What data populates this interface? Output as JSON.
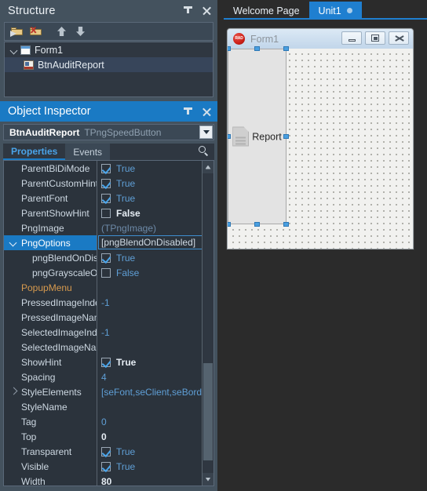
{
  "structure": {
    "title": "Structure",
    "title_actions": [
      {
        "name": "pin-icon",
        "label": "Pin"
      },
      {
        "name": "close-icon",
        "label": "Close"
      }
    ],
    "toolbar": [
      {
        "name": "new-folder-button",
        "icon": "folder-new-icon"
      },
      {
        "name": "delete-folder-button",
        "icon": "folder-delete-icon"
      },
      {
        "name": "move-up-button",
        "icon": "arrow-up-icon"
      },
      {
        "name": "move-down-button",
        "icon": "arrow-down-icon"
      }
    ],
    "tree": [
      {
        "label": "Form1",
        "icon": "form-icon",
        "level": 0,
        "expanded": true,
        "selected": false
      },
      {
        "label": "BtnAuditReport",
        "icon": "speedbutton-icon",
        "level": 1,
        "expanded": false,
        "selected": true
      }
    ]
  },
  "object_inspector": {
    "title": "Object Inspector",
    "object_name": "BtnAuditReport",
    "object_type": "TPngSpeedButton",
    "tabs": [
      {
        "label": "Properties",
        "active": true
      },
      {
        "label": "Events",
        "active": false
      }
    ],
    "search_placeholder": "",
    "search_value": "",
    "properties": [
      {
        "name": "ParentBiDiMode",
        "value": "True",
        "kind": "bool",
        "checked": true,
        "bold": false,
        "indent": 0,
        "expander": "",
        "selected": false,
        "category": false
      },
      {
        "name": "ParentCustomHint",
        "value": "True",
        "kind": "bool",
        "checked": true,
        "bold": false,
        "indent": 0,
        "expander": "",
        "selected": false,
        "category": false
      },
      {
        "name": "ParentFont",
        "value": "True",
        "kind": "bool",
        "checked": true,
        "bold": false,
        "indent": 0,
        "expander": "",
        "selected": false,
        "category": false
      },
      {
        "name": "ParentShowHint",
        "value": "False",
        "kind": "bool",
        "checked": false,
        "bold": true,
        "indent": 0,
        "expander": "",
        "selected": false,
        "category": false
      },
      {
        "name": "PngImage",
        "value": "(TPngImage)",
        "kind": "text",
        "dim": true,
        "bold": false,
        "indent": 0,
        "expander": "",
        "selected": false,
        "category": false
      },
      {
        "name": "PngOptions",
        "value": "[pngBlendOnDisabled]",
        "kind": "editing",
        "bold": false,
        "indent": 0,
        "expander": "expanded",
        "selected": true,
        "category": false
      },
      {
        "name": "pngBlendOnDisabled",
        "value": "True",
        "kind": "bool",
        "checked": true,
        "bold": false,
        "indent": 1,
        "expander": "",
        "selected": false,
        "category": false
      },
      {
        "name": "pngGrayscaleOnDisabled",
        "value": "False",
        "kind": "bool",
        "checked": false,
        "bold": false,
        "indent": 1,
        "expander": "",
        "selected": false,
        "category": false
      },
      {
        "name": "PopupMenu",
        "value": "",
        "kind": "text",
        "bold": false,
        "indent": 0,
        "expander": "",
        "selected": false,
        "category": true
      },
      {
        "name": "PressedImageIndex",
        "value": "-1",
        "kind": "text",
        "bold": false,
        "indent": 0,
        "expander": "",
        "selected": false,
        "category": false
      },
      {
        "name": "PressedImageName",
        "value": "",
        "kind": "text",
        "bold": false,
        "indent": 0,
        "expander": "",
        "selected": false,
        "category": false
      },
      {
        "name": "SelectedImageIndex",
        "value": "-1",
        "kind": "text",
        "bold": false,
        "indent": 0,
        "expander": "",
        "selected": false,
        "category": false
      },
      {
        "name": "SelectedImageName",
        "value": "",
        "kind": "text",
        "bold": false,
        "indent": 0,
        "expander": "",
        "selected": false,
        "category": false
      },
      {
        "name": "ShowHint",
        "value": "True",
        "kind": "bool",
        "checked": true,
        "bold": true,
        "indent": 0,
        "expander": "",
        "selected": false,
        "category": false
      },
      {
        "name": "Spacing",
        "value": "4",
        "kind": "text",
        "bold": false,
        "indent": 0,
        "expander": "",
        "selected": false,
        "category": false
      },
      {
        "name": "StyleElements",
        "value": "[seFont,seClient,seBorder]",
        "kind": "text",
        "bold": false,
        "indent": 0,
        "expander": "collapsed",
        "selected": false,
        "category": false
      },
      {
        "name": "StyleName",
        "value": "",
        "kind": "text",
        "bold": false,
        "indent": 0,
        "expander": "",
        "selected": false,
        "category": false
      },
      {
        "name": "Tag",
        "value": "0",
        "kind": "text",
        "bold": false,
        "indent": 0,
        "expander": "",
        "selected": false,
        "category": false
      },
      {
        "name": "Top",
        "value": "0",
        "kind": "text",
        "bold": true,
        "indent": 0,
        "expander": "",
        "selected": false,
        "category": false
      },
      {
        "name": "Transparent",
        "value": "True",
        "kind": "bool",
        "checked": true,
        "bold": false,
        "indent": 0,
        "expander": "",
        "selected": false,
        "category": false
      },
      {
        "name": "Visible",
        "value": "True",
        "kind": "bool",
        "checked": true,
        "bold": false,
        "indent": 0,
        "expander": "",
        "selected": false,
        "category": false
      },
      {
        "name": "Width",
        "value": "80",
        "kind": "text",
        "bold": true,
        "indent": 0,
        "expander": "",
        "selected": false,
        "category": false
      }
    ]
  },
  "editor": {
    "tabs": [
      {
        "label": "Welcome Page",
        "active": false,
        "modified": false
      },
      {
        "label": "Unit1",
        "active": true,
        "modified": true
      }
    ]
  },
  "designer": {
    "form_caption": "Form1",
    "logo_text": "RAD",
    "window_buttons": [
      {
        "name": "minimize-button",
        "icon": "minimize-icon"
      },
      {
        "name": "maximize-button",
        "icon": "maximize-icon"
      },
      {
        "name": "close-button",
        "icon": "close-icon"
      }
    ],
    "selected_control": {
      "label": "Report",
      "icon": "document-icon",
      "name": "BtnAuditReport"
    }
  },
  "colors": {
    "accent": "#1a7ac4",
    "panel_bg": "#44525e",
    "grid_bg": "#2b333c",
    "value_text": "#5f9fd6",
    "category_text": "#d79a4e",
    "tab_active": "#1f7fd0"
  }
}
